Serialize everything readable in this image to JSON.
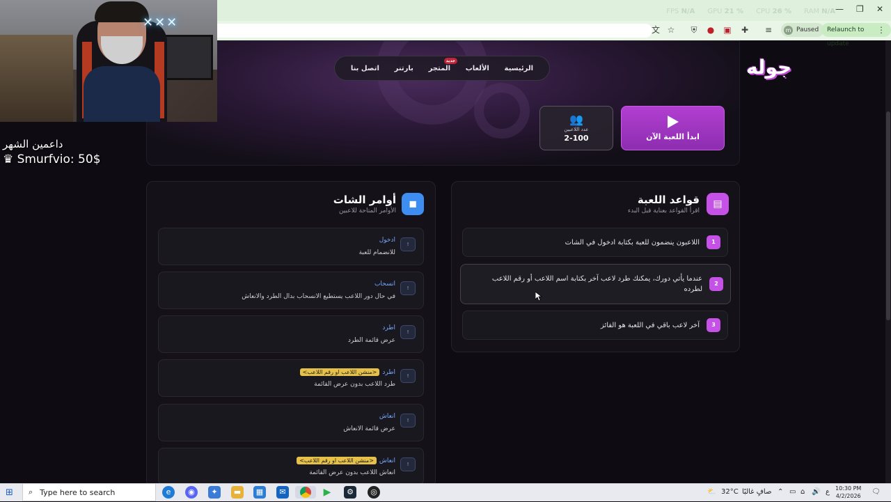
{
  "browser": {
    "stats": [
      "FPS",
      "N/A",
      "GPU",
      "21 %",
      "CPU",
      "26 %",
      "RAM",
      "N/A"
    ],
    "paused_label": "Paused",
    "profile_initial": "m",
    "relaunch_label": "Relaunch to update"
  },
  "site": {
    "logo": "جوله",
    "nav": [
      "الرئيسية",
      "الألعاب",
      "المتجر",
      "بارتنر",
      "اتصل بنا"
    ],
    "nav_badge": "جديد",
    "start_button": "ابدأ اللعبة الآن",
    "players_label": "عدد اللاعبين",
    "players_value": "2-100"
  },
  "rules": {
    "title": "قواعد اللعبة",
    "subtitle": "اقرأ القواعد بعناية قبل البدء",
    "items": [
      {
        "num": "1",
        "text": "اللاعبون ينضمون للعبة بكتابة ادخول في الشات"
      },
      {
        "num": "2",
        "text": "عندما يأتي دورك، يمكنك طرد لاعب آخر بكتابة اسم اللاعب أو رقم اللاعب لطرده"
      },
      {
        "num": "3",
        "text": "آخر لاعب باقي في اللعبة هو الفائز"
      }
    ]
  },
  "commands": {
    "title": "أوامر الشات",
    "subtitle": "الأوامر المتاحة للاعبين",
    "items": [
      {
        "icon": "!",
        "name": "ادخول",
        "arg": "",
        "desc": "للانضمام للعبة"
      },
      {
        "icon": "!",
        "name": "انسحاب",
        "arg": "",
        "desc": "في حال دور اللاعب يستطيع الانسحاب بدال الطرد والانعاش"
      },
      {
        "icon": "!",
        "name": "اطرد",
        "arg": "",
        "desc": "عرض قائمة الطرد"
      },
      {
        "icon": "!",
        "name": "اطرد",
        "arg": "<منشن اللاعب او رقم اللاعب>",
        "desc": "طرد اللاعب بدون عرض القائمة"
      },
      {
        "icon": "!",
        "name": "انعاش",
        "arg": "",
        "desc": "عرض قائمة الانعاش"
      },
      {
        "icon": "!",
        "name": "انعاش",
        "arg": "<منشن اللاعب او رقم اللاعب>",
        "desc": "انعاش اللاعب بدون عرض القائمة"
      }
    ]
  },
  "stream": {
    "neon_sign": "✕✕✕",
    "supporters_title": "داعمين الشهر",
    "supporter": "♛ Smurfvio: 50$"
  },
  "taskbar": {
    "search_placeholder": "Type here to search",
    "weather": "32°C",
    "weather_text": "صافٍ غالبًا",
    "lang": "ع",
    "time": "10:30 PM",
    "date": "4/2/2026"
  }
}
